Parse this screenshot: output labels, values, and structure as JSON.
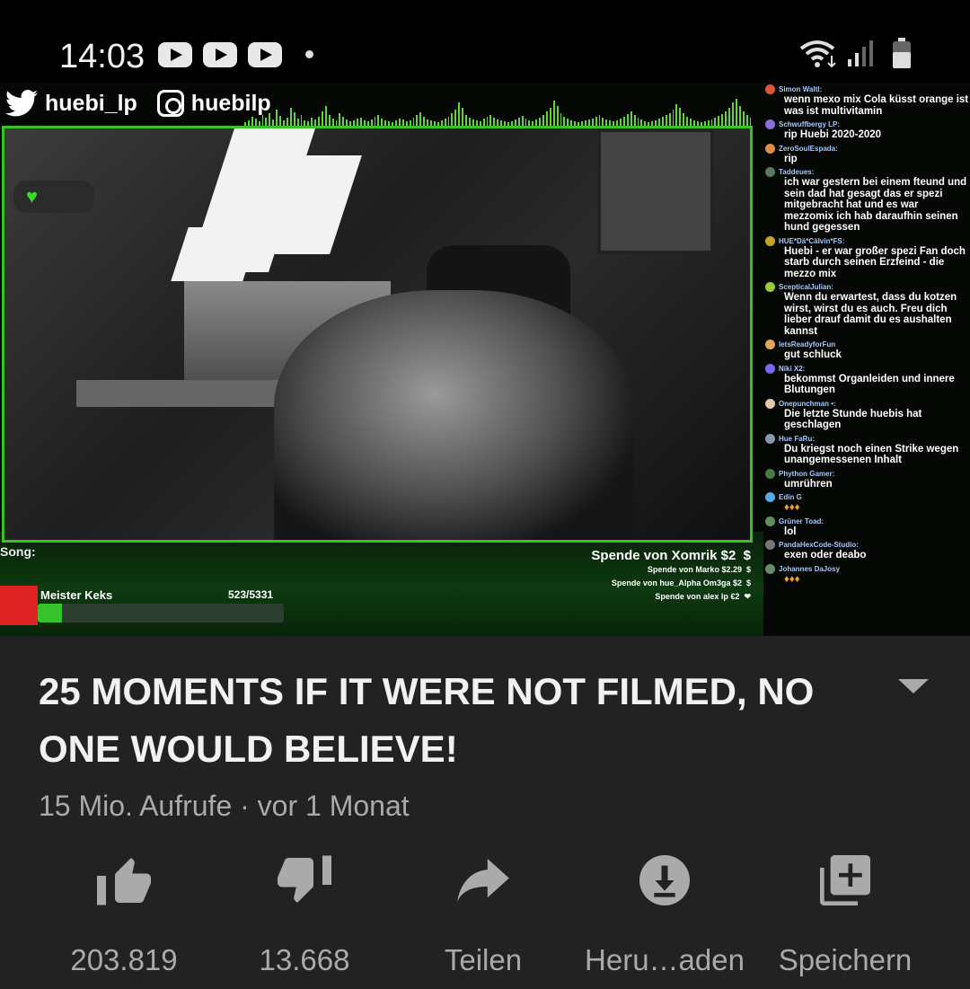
{
  "status_bar": {
    "time": "14:03",
    "notification_icons": [
      "youtube-icon",
      "youtube-icon",
      "youtube-icon"
    ],
    "right_icons": [
      "wifi-icon",
      "signal-icon",
      "battery-icon"
    ]
  },
  "stream_overlay": {
    "twitter_handle": "huebi_lp",
    "instagram_handle": "huebilp",
    "song_label": "Song:",
    "donation_main": "Spende von Xomrik $2",
    "donation_main_symbol": "$",
    "donations_recent": [
      {
        "text": "Spende von Marko $2.29",
        "symbol": "$"
      },
      {
        "text": "Spende von hue_Alpha Om3ga $2",
        "symbol": "$"
      },
      {
        "text": "Spende von alex lp €2",
        "symbol": "❤"
      }
    ],
    "goal_name": "Meister Keks",
    "goal_count": "523/5331",
    "goal_progress": 0.098,
    "accent_color": "#38c228"
  },
  "chat": [
    {
      "user": "Simon Waltl:",
      "text": "wenn mexo mix Cola küsst orange ist was ist multivitamin",
      "avatar_color": "#e0533b"
    },
    {
      "user": "Schwuffbergy LP:",
      "text": "rip Huebi 2020-2020",
      "avatar_color": "#8a6fd6"
    },
    {
      "user": "ZeroSoulEspada:",
      "text": "rip",
      "avatar_color": "#d98e4c"
    },
    {
      "user": "Taddeues:",
      "text": "ich war gestern bei einem fteund und sein dad hat gesagt das er spezi mitgebracht hat und es war mezzomix ich hab daraufhin seinen hund gegessen",
      "avatar_color": "#5a7a5a"
    },
    {
      "user": "HUE*Dä*Cälvin*FS:",
      "text": "Huebi - er war großer spezi Fan doch starb durch seinen Erzfeind - die mezzo mix",
      "avatar_color": "#c9a227"
    },
    {
      "user": "ScepticalJulian:",
      "text": "Wenn du erwartest, dass du kotzen wirst, wirst du es auch. Freu dich lieber drauf damit du es aushalten kannst",
      "avatar_color": "#9acd32"
    },
    {
      "user": "letsReadyforFun",
      "text": "gut schluck",
      "avatar_color": "#e5a35b"
    },
    {
      "user": "Niki X2:",
      "text": "bekommst Organleiden und innere Blutungen",
      "avatar_color": "#7b68ee"
    },
    {
      "user": "Onepunchman •:",
      "text": "Die letzte Stunde huebis hat geschlagen",
      "avatar_color": "#e0c8a8"
    },
    {
      "user": "Hue FaRu:",
      "text": "Du kriegst noch einen Strike wegen unangemessenen Inhalt",
      "avatar_color": "#8899aa"
    },
    {
      "user": "Phython Gamer:",
      "text": "umrühren",
      "avatar_color": "#4a7a4a"
    },
    {
      "user": "Edin G",
      "text": "",
      "avatar_color": "#5aa9e6"
    },
    {
      "user": "Grüner Toad:",
      "text": "lol",
      "avatar_color": "#5f8f5f"
    },
    {
      "user": "PandaHexCode-Studio:",
      "text": "exen oder deabo",
      "avatar_color": "#777777"
    },
    {
      "user": "Johannes DaJosy",
      "text": "",
      "avatar_color": "#6a8a6a"
    }
  ],
  "video": {
    "title": "25 MOMENTS IF IT WERE NOT FILMED, NO ONE WOULD BELIEVE!",
    "meta": "15 Mio. Aufrufe · vor 1 Monat"
  },
  "actions": [
    {
      "label": "203.819",
      "icon": "thumb-up-icon"
    },
    {
      "label": "13.668",
      "icon": "thumb-down-icon"
    },
    {
      "label": "Teilen",
      "icon": "share-icon"
    },
    {
      "label": "Heru…aden",
      "icon": "download-icon"
    },
    {
      "label": "Speichern",
      "icon": "save-to-playlist-icon"
    }
  ]
}
